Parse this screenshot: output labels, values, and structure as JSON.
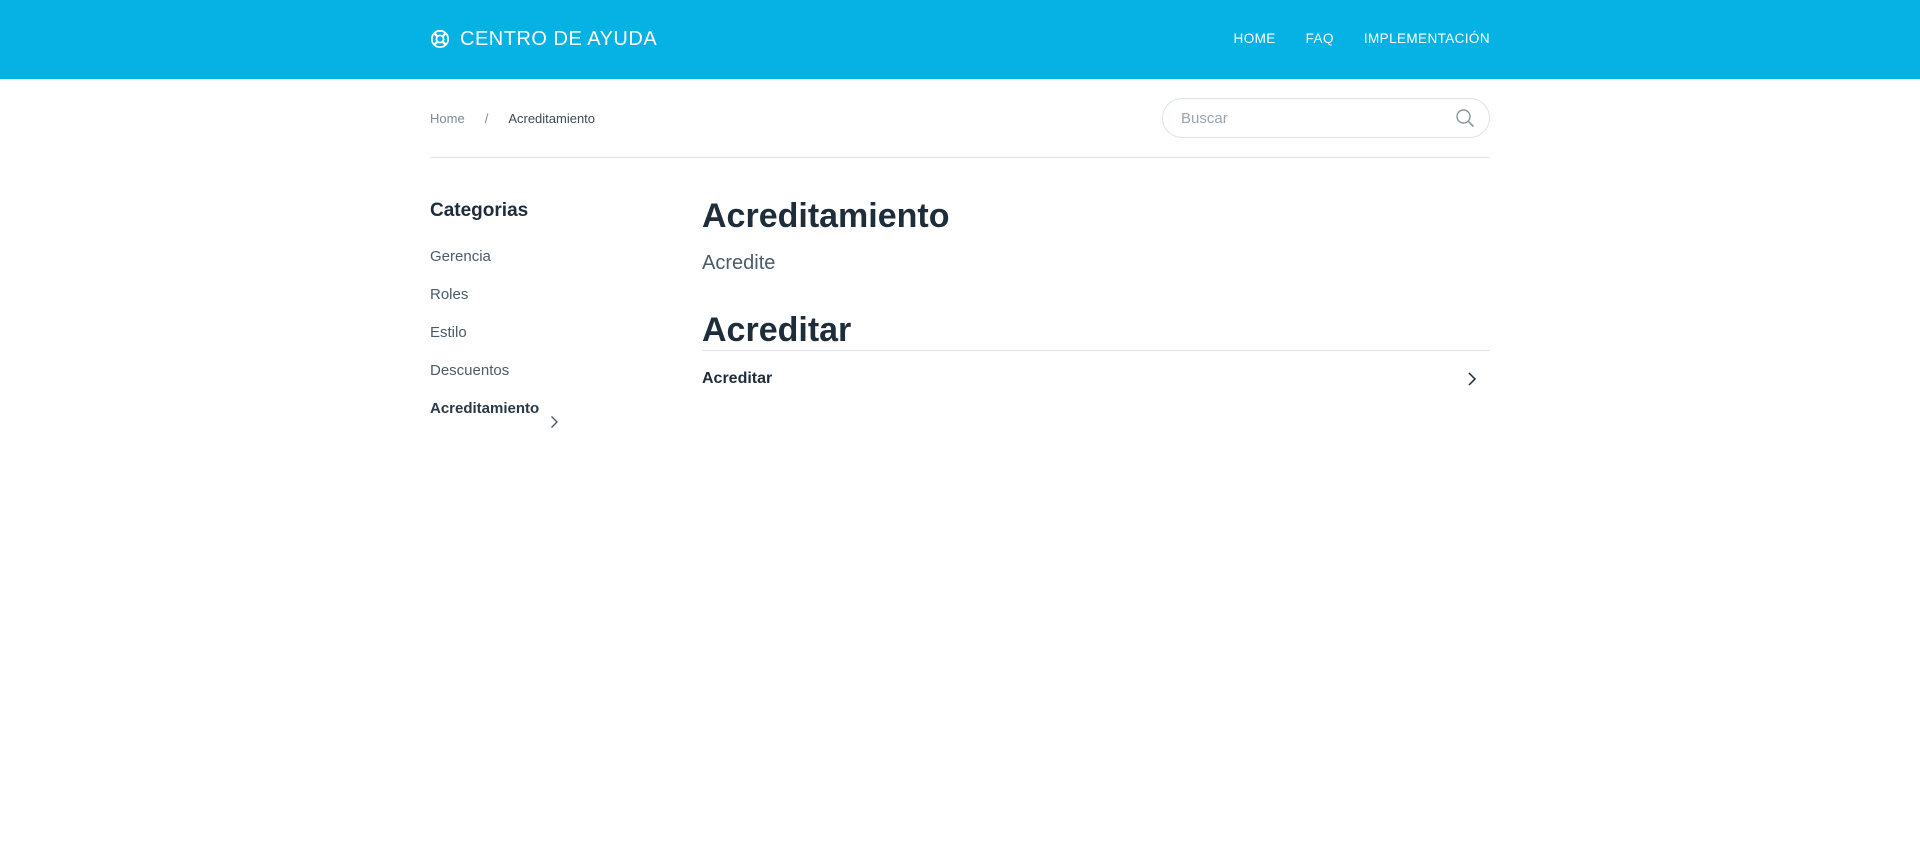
{
  "header": {
    "brand_title": "CENTRO DE AYUDA",
    "logo_icon": "lifebuoy-icon",
    "nav": [
      {
        "label": "HOME"
      },
      {
        "label": "FAQ"
      },
      {
        "label": "IMPLEMENTACIÓN"
      }
    ],
    "background_color": "#06b2e3"
  },
  "breadcrumb": {
    "home": "Home",
    "separator": "/",
    "current": "Acreditamiento"
  },
  "search": {
    "placeholder": "Buscar",
    "value": "",
    "icon": "search-icon"
  },
  "sidebar": {
    "title": "Categorias",
    "items": [
      {
        "label": "Gerencia"
      },
      {
        "label": "Roles"
      },
      {
        "label": "Estilo"
      },
      {
        "label": "Descuentos"
      },
      {
        "label": "Acreditamiento",
        "active": true
      }
    ]
  },
  "main": {
    "title": "Acreditamiento",
    "description": "Acredite",
    "sections": [
      {
        "title": "Acreditar",
        "articles": [
          {
            "label": "Acreditar"
          }
        ]
      }
    ]
  }
}
